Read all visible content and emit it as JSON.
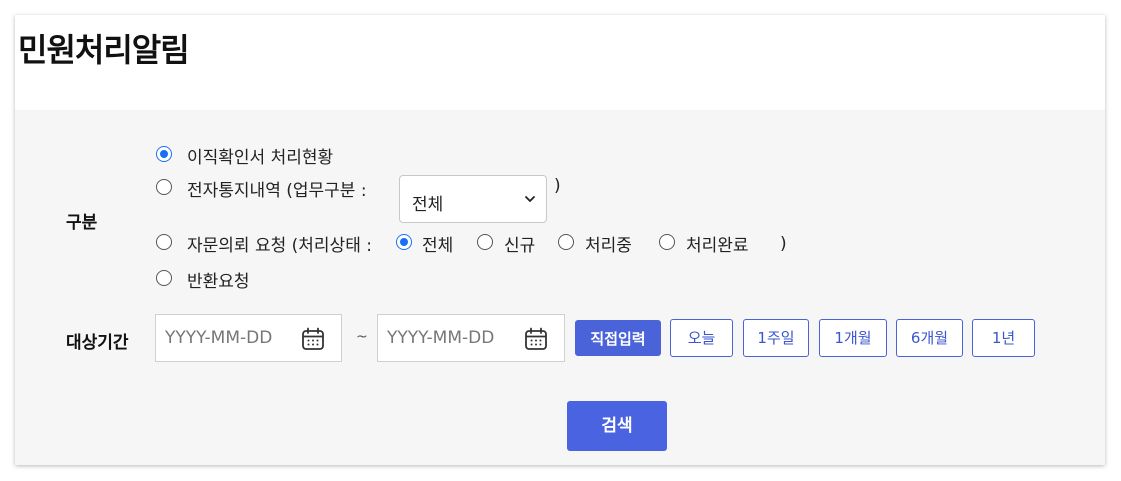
{
  "page": {
    "title": "민원처리알림"
  },
  "filters": {
    "category_label": "구분",
    "period_label": "대상기간",
    "options": {
      "confirm_status": "이직확인서 처리현황",
      "e_notice": "전자통지내역 (업무구분 :",
      "e_notice_close": ")",
      "consult": "자문의뢰 요청 (처리상태 :",
      "consult_close": ")",
      "return": "반환요청"
    },
    "work_type_select": {
      "selected": "전체"
    },
    "status_options": [
      "전체",
      "신규",
      "처리중",
      "처리완료"
    ],
    "selected_option": "이직확인서 처리현황",
    "selected_status": "전체"
  },
  "period": {
    "start_placeholder": "YYYY-MM-DD",
    "end_placeholder": "YYYY-MM-DD",
    "separator": "~",
    "buttons": [
      "직접입력",
      "오늘",
      "1주일",
      "1개월",
      "6개월",
      "1년"
    ],
    "active_button": "직접입력"
  },
  "actions": {
    "search_label": "검색"
  },
  "colors": {
    "accent": "#4a63d8",
    "radio_checked": "#1a6ef5",
    "panel_bg": "#f6f6f6"
  },
  "icons": {
    "calendar": "calendar-icon",
    "dropdown": "chevron-down-icon"
  }
}
